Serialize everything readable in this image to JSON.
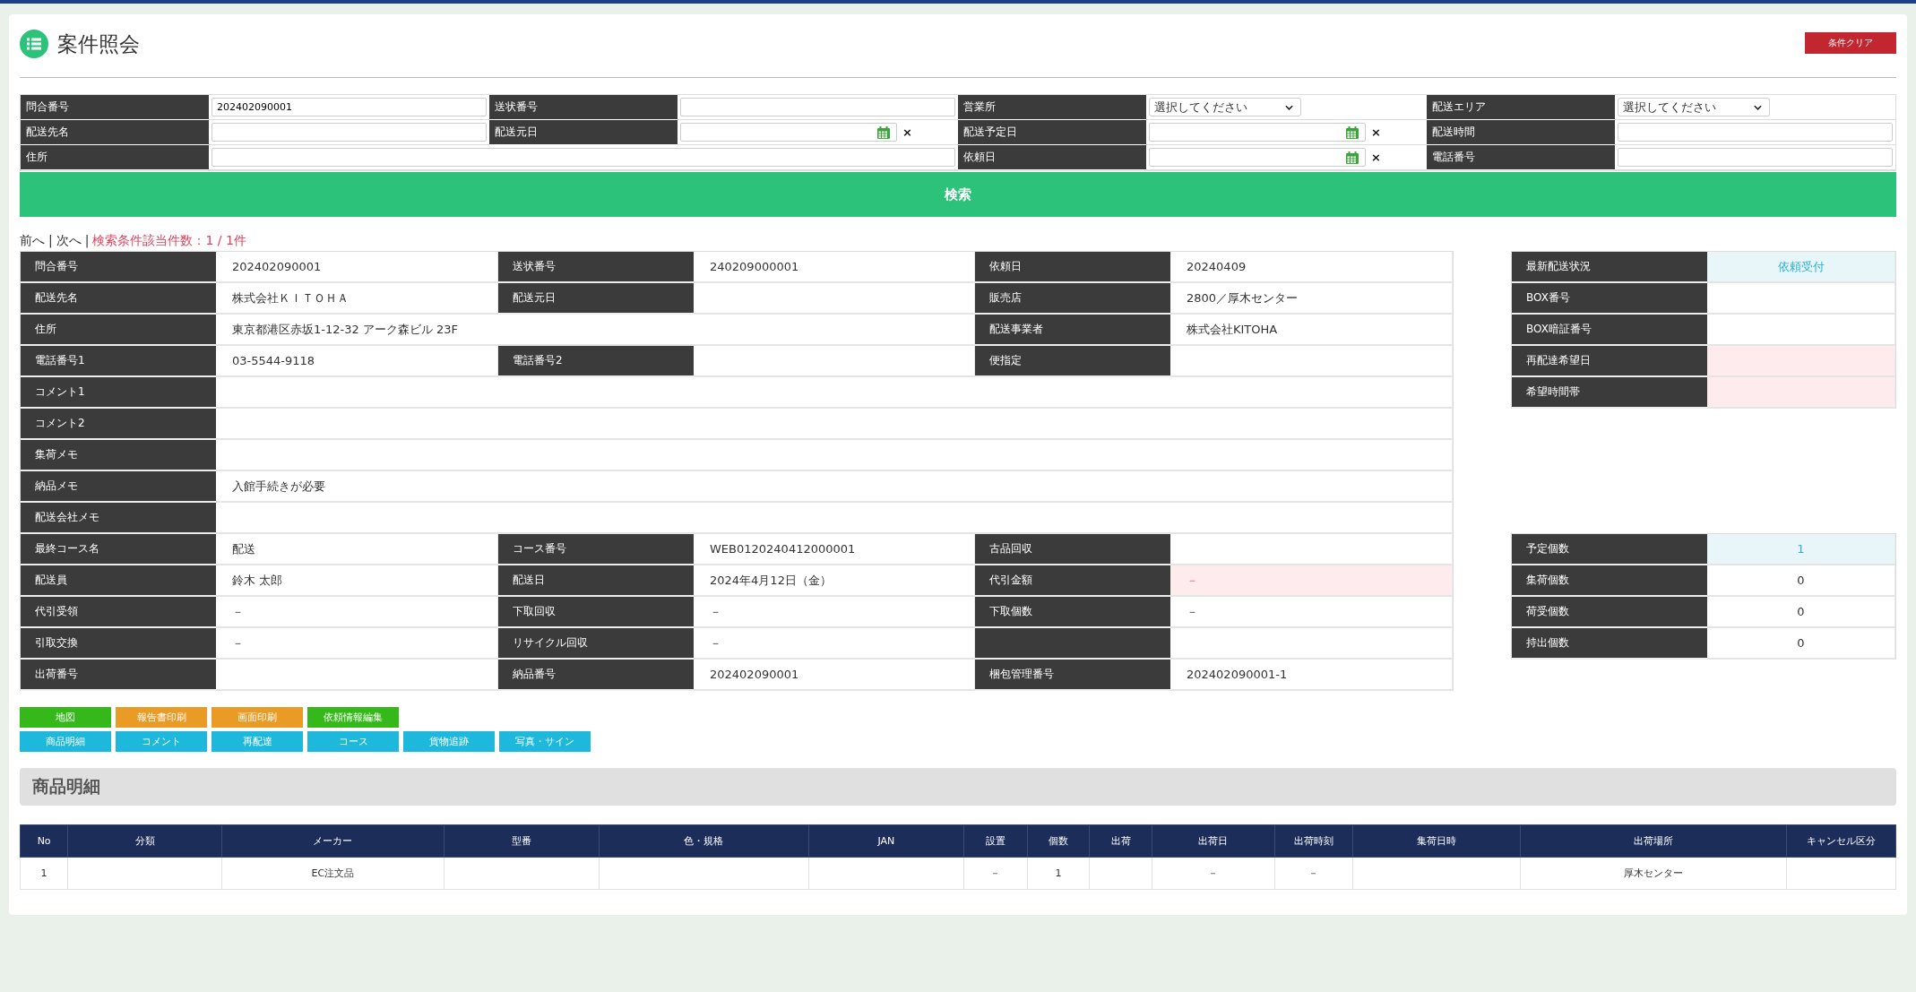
{
  "page": {
    "title": "案件照会",
    "clear_button": "条件クリア"
  },
  "search_form": {
    "rows": [
      [
        {
          "label": "問合番号",
          "field": {
            "kind": "text",
            "value": "202402090001"
          }
        },
        {
          "label": "送状番号",
          "field": {
            "kind": "text"
          }
        },
        {
          "label": "営業所",
          "field": {
            "kind": "select",
            "value": "選択してください"
          }
        },
        {
          "label": "配送エリア",
          "field": {
            "kind": "select",
            "value": "選択してください"
          }
        }
      ],
      [
        {
          "label": "配送先名",
          "field": {
            "kind": "text"
          }
        },
        {
          "label": "配送元日",
          "field": {
            "kind": "date",
            "clear": "×"
          }
        },
        {
          "label": "配送予定日",
          "field": {
            "kind": "date",
            "clear": "×"
          }
        },
        {
          "label": "配送時間",
          "field": {
            "kind": "text"
          }
        }
      ],
      [
        {
          "label": "住所",
          "field": {
            "kind": "wide_text"
          }
        },
        "",
        {
          "label": "依頼日",
          "field": {
            "kind": "date",
            "clear": "×"
          }
        },
        {
          "label": "電話番号",
          "field": {
            "kind": "text"
          }
        }
      ]
    ],
    "search_button": "検索"
  },
  "nav": [
    {
      "kind": "link",
      "text": "前へ"
    },
    {
      "kind": "separator",
      "text": "|"
    },
    {
      "kind": "link",
      "text": "次へ"
    },
    {
      "kind": "separator",
      "text": "|"
    },
    {
      "kind": "count",
      "text": "検索条件該当件数：1 / 1件"
    }
  ],
  "detail": {
    "rows": [
      {
        "kind": "three",
        "cells": [
          {
            "label": "問合番号",
            "value": "202402090001"
          },
          {
            "label": "送状番号",
            "value": "240209000001"
          },
          {
            "label": "依頼日",
            "value": "20240409"
          }
        ]
      },
      {
        "kind": "three",
        "cells": [
          {
            "label": "配送先名",
            "value": "株式会社ＫＩＴＯＨＡ"
          },
          {
            "label": "配送元日"
          },
          {
            "label": "販売店",
            "value": "2800／厚木センター"
          }
        ]
      },
      {
        "kind": "address",
        "cells": [
          {
            "label": "住所",
            "value": "東京都港区赤坂1-12-32 アーク森ビル 23F"
          },
          "",
          {
            "label": "配送事業者",
            "value": "株式会社KITOHA"
          }
        ]
      },
      {
        "kind": "three",
        "cells": [
          {
            "label": "電話番号1",
            "value": "03-5544-9118"
          },
          {
            "label": "電話番号2"
          },
          {
            "label": "便指定"
          }
        ]
      },
      {
        "kind": "full",
        "cells": [
          {
            "label": "コメント1"
          }
        ]
      },
      {
        "kind": "full",
        "cells": [
          {
            "label": "コメント2"
          }
        ]
      },
      {
        "kind": "full",
        "cells": [
          {
            "label": "集荷メモ"
          }
        ]
      },
      {
        "kind": "full",
        "cells": [
          {
            "label": "納品メモ",
            "value": "入館手続きが必要"
          }
        ]
      },
      {
        "kind": "full",
        "cells": [
          {
            "label": "配送会社メモ"
          }
        ]
      },
      {
        "kind": "three",
        "cells": [
          {
            "label": "最終コース名",
            "value": "配送"
          },
          {
            "label": "コース番号",
            "value": "WEB0120240412000001"
          },
          {
            "label": "古品回収"
          }
        ]
      },
      {
        "kind": "three",
        "cells": [
          {
            "label": "配送員",
            "value": "鈴木 太郎"
          },
          {
            "label": "配送日",
            "value": "2024年4月12日（金）"
          },
          {
            "label": "代引金額",
            "value": "－",
            "color": "#fdebee"
          }
        ]
      },
      {
        "kind": "three",
        "cells": [
          {
            "label": "代引受領",
            "value": "－"
          },
          {
            "label": "下取回収",
            "value": "－"
          },
          {
            "label": "下取個数",
            "value": "－"
          }
        ]
      },
      {
        "kind": "three",
        "cells": [
          {
            "label": "引取交換",
            "value": "－"
          },
          {
            "label": "リサイクル回収",
            "value": "－"
          },
          {}
        ]
      },
      {
        "kind": "three",
        "cells": [
          {
            "label": "出荷番号"
          },
          {
            "label": "納品番号",
            "value": "202402090001"
          },
          {
            "label": "梱包管理番号",
            "value": "202402090001-1"
          }
        ]
      }
    ],
    "status": [
      {
        "label": "最新配送状況",
        "value": "依頼受付",
        "color": "#e8f6fa"
      },
      {
        "label": "BOX番号"
      },
      {
        "label": "BOX暗証番号"
      },
      {
        "label": "再配達希望日",
        "color": "#fdebee"
      },
      {
        "label": "希望時間帯",
        "color": "#fdebee"
      }
    ],
    "counts": [
      {
        "label": "予定個数",
        "value": "1",
        "color": "#e8f6fa"
      },
      {
        "label": "集荷個数",
        "value": "0"
      },
      {
        "label": "荷受個数",
        "value": "0"
      },
      {
        "label": "持出個数",
        "value": "0"
      }
    ]
  },
  "action_buttons": [
    [
      {
        "text": "地図",
        "color": "#35b91a"
      },
      {
        "text": "報告書印刷",
        "color": "#e99b26"
      },
      {
        "text": "画面印刷",
        "color": "#e99b26"
      },
      {
        "text": "依頼情報編集",
        "color": "#35b91a"
      }
    ],
    [
      {
        "text": "商品明細",
        "color": "#1db8db"
      },
      {
        "text": "コメント",
        "color": "#1db8db"
      },
      {
        "text": "再配達",
        "color": "#1db8db"
      },
      {
        "text": "コース",
        "color": "#1db8db"
      },
      {
        "text": "貨物追跡",
        "color": "#1db8db"
      },
      {
        "text": "写真・サイン",
        "color": "#1db8db"
      }
    ]
  ],
  "items": {
    "heading": "商品明細",
    "columns": [
      "No",
      "分類",
      "メーカー",
      "型番",
      "色・規格",
      "JAN",
      "設置",
      "個数",
      "出荷",
      "出荷日",
      "出荷時刻",
      "集荷日時",
      "出荷場所",
      "キャンセル区分"
    ],
    "rows": [
      [
        "1",
        null,
        "EC注文品",
        null,
        null,
        null,
        "－",
        "1",
        null,
        "－",
        "－",
        null,
        "厚木センター",
        null
      ]
    ]
  }
}
